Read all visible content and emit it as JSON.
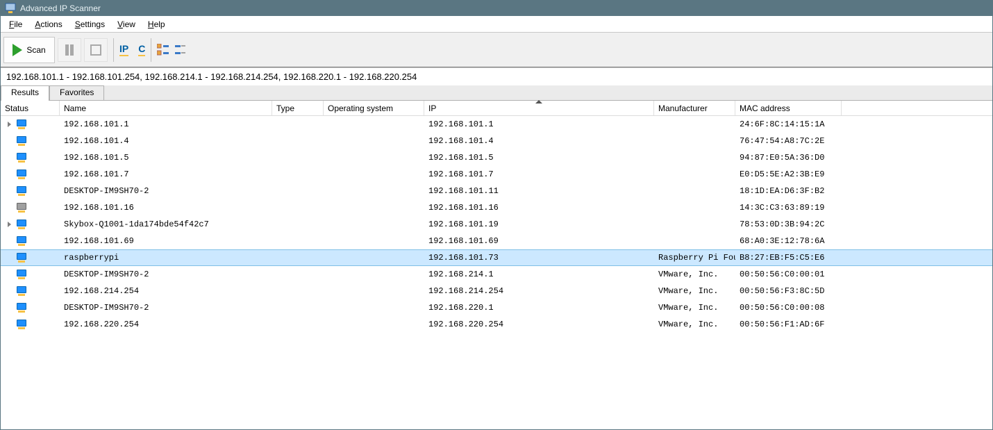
{
  "titlebar": {
    "title": "Advanced IP Scanner"
  },
  "menu": {
    "file": "File",
    "actions": "Actions",
    "settings": "Settings",
    "view": "View",
    "help": "Help"
  },
  "toolbar": {
    "scan_label": "Scan"
  },
  "ip_range": {
    "value": "192.168.101.1 - 192.168.101.254, 192.168.214.1 - 192.168.214.254, 192.168.220.1 - 192.168.220.254"
  },
  "tabs": {
    "results": "Results",
    "favorites": "Favorites"
  },
  "columns": {
    "status": "Status",
    "name": "Name",
    "type": "Type",
    "os": "Operating system",
    "ip": "IP",
    "mfr": "Manufacturer",
    "mac": "MAC address"
  },
  "rows": [
    {
      "expand": true,
      "offline": false,
      "name": "192.168.101.1",
      "ip": "192.168.101.1",
      "mfr": "",
      "mac": "24:6F:8C:14:15:1A",
      "selected": false
    },
    {
      "expand": false,
      "offline": false,
      "name": "192.168.101.4",
      "ip": "192.168.101.4",
      "mfr": "",
      "mac": "76:47:54:A8:7C:2E",
      "selected": false
    },
    {
      "expand": false,
      "offline": false,
      "name": "192.168.101.5",
      "ip": "192.168.101.5",
      "mfr": "",
      "mac": "94:87:E0:5A:36:D0",
      "selected": false
    },
    {
      "expand": false,
      "offline": false,
      "name": "192.168.101.7",
      "ip": "192.168.101.7",
      "mfr": "",
      "mac": "E0:D5:5E:A2:3B:E9",
      "selected": false
    },
    {
      "expand": false,
      "offline": false,
      "name": "DESKTOP-IM9SH70-2",
      "ip": "192.168.101.11",
      "mfr": "",
      "mac": "18:1D:EA:D6:3F:B2",
      "selected": false
    },
    {
      "expand": false,
      "offline": true,
      "name": "192.168.101.16",
      "ip": "192.168.101.16",
      "mfr": "",
      "mac": "14:3C:C3:63:89:19",
      "selected": false
    },
    {
      "expand": true,
      "offline": false,
      "name": "Skybox-Q1001-1da174bde54f42c7",
      "ip": "192.168.101.19",
      "mfr": "",
      "mac": "78:53:0D:3B:94:2C",
      "selected": false
    },
    {
      "expand": false,
      "offline": false,
      "name": "192.168.101.69",
      "ip": "192.168.101.69",
      "mfr": "",
      "mac": "68:A0:3E:12:78:6A",
      "selected": false
    },
    {
      "expand": false,
      "offline": false,
      "name": "raspberrypi",
      "ip": "192.168.101.73",
      "mfr": "Raspberry Pi Fou…",
      "mac": "B8:27:EB:F5:C5:E6",
      "selected": true
    },
    {
      "expand": false,
      "offline": false,
      "name": "DESKTOP-IM9SH70-2",
      "ip": "192.168.214.1",
      "mfr": "VMware, Inc.",
      "mac": "00:50:56:C0:00:01",
      "selected": false
    },
    {
      "expand": false,
      "offline": false,
      "name": "192.168.214.254",
      "ip": "192.168.214.254",
      "mfr": "VMware, Inc.",
      "mac": "00:50:56:F3:8C:5D",
      "selected": false
    },
    {
      "expand": false,
      "offline": false,
      "name": "DESKTOP-IM9SH70-2",
      "ip": "192.168.220.1",
      "mfr": "VMware, Inc.",
      "mac": "00:50:56:C0:00:08",
      "selected": false
    },
    {
      "expand": false,
      "offline": false,
      "name": "192.168.220.254",
      "ip": "192.168.220.254",
      "mfr": "VMware, Inc.",
      "mac": "00:50:56:F1:AD:6F",
      "selected": false
    }
  ]
}
